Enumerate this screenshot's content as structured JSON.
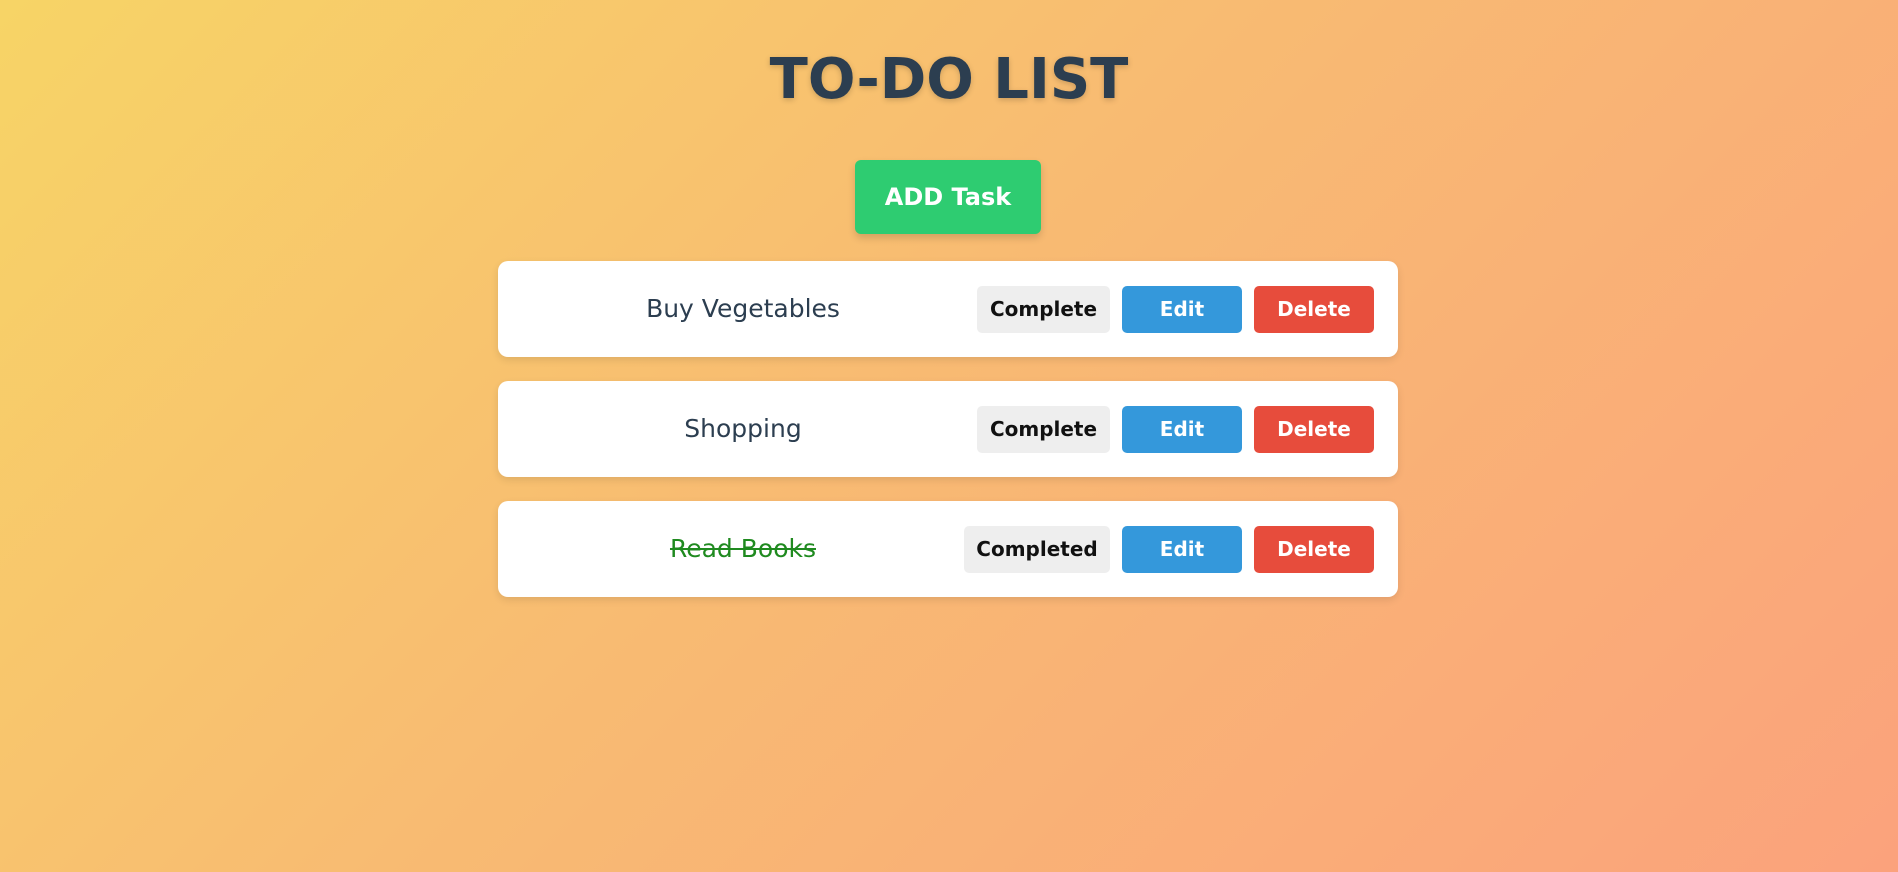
{
  "app": {
    "title": "TO-DO LIST",
    "add_button_label": "ADD Task"
  },
  "tasks": [
    {
      "text": "Buy Vegetables",
      "completed": false,
      "status_label": "Complete",
      "edit_label": "Edit",
      "delete_label": "Delete"
    },
    {
      "text": "Shopping",
      "completed": false,
      "status_label": "Complete",
      "edit_label": "Edit",
      "delete_label": "Delete"
    },
    {
      "text": "Read Books",
      "completed": true,
      "status_label": "Completed",
      "edit_label": "Edit",
      "delete_label": "Delete"
    }
  ],
  "colors": {
    "add": "#2ecc71",
    "edit": "#3498db",
    "delete": "#e74c3c",
    "completed_text": "#1f8a1f",
    "title": "#2c3e50"
  }
}
